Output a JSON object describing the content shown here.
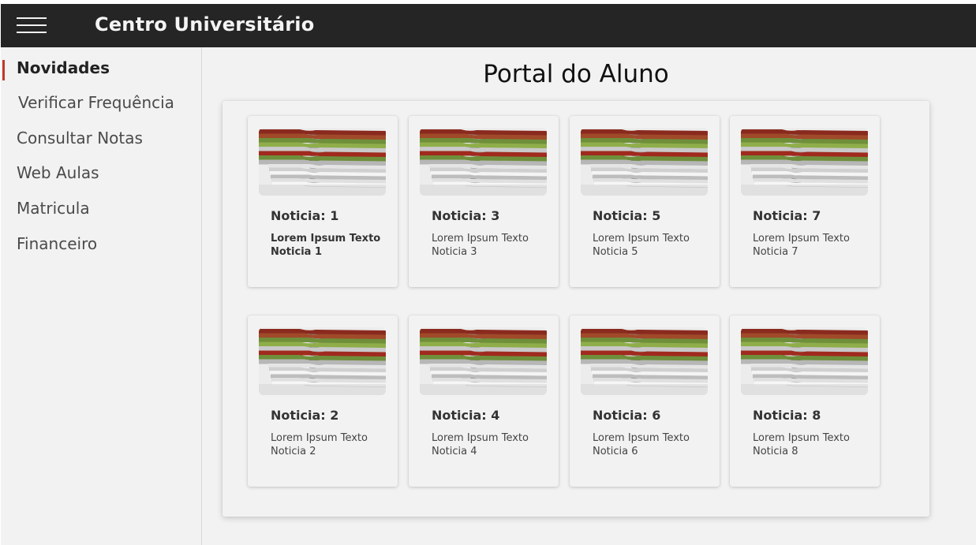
{
  "header": {
    "title": "Centro Universitário",
    "menu_icon": "hamburger-menu-icon"
  },
  "sidebar": {
    "items": [
      {
        "label": "Novidades",
        "active": true
      },
      {
        "label": "Verificar Frequência",
        "active": false
      },
      {
        "label": "Consultar Notas",
        "active": false
      },
      {
        "label": "Web Aulas",
        "active": false
      },
      {
        "label": "Matricula",
        "active": false
      },
      {
        "label": "Financeiro",
        "active": false
      }
    ]
  },
  "main": {
    "title": "Portal do Aluno",
    "cards": [
      {
        "title": "Noticia: 1",
        "text": "Lorem Ipsum Texto Noticia 1",
        "image": "newspaper-stack-image"
      },
      {
        "title": "Noticia: 3",
        "text": "Lorem Ipsum Texto Noticia 3",
        "image": "newspaper-stack-image"
      },
      {
        "title": "Noticia: 5",
        "text": "Lorem Ipsum Texto Noticia 5",
        "image": "newspaper-stack-image"
      },
      {
        "title": "Noticia: 7",
        "text": "Lorem Ipsum Texto Noticia 7",
        "image": "newspaper-stack-image"
      },
      {
        "title": "Noticia: 2",
        "text": "Lorem Ipsum Texto Noticia 2",
        "image": "newspaper-stack-image"
      },
      {
        "title": "Noticia: 4",
        "text": "Lorem Ipsum Texto Noticia 4",
        "image": "newspaper-stack-image"
      },
      {
        "title": "Noticia: 6",
        "text": "Lorem Ipsum Texto Noticia 6",
        "image": "newspaper-stack-image"
      },
      {
        "title": "Noticia: 8",
        "text": "Lorem Ipsum Texto Noticia 8",
        "image": "newspaper-stack-image"
      }
    ]
  },
  "colors": {
    "topbar": "#252525",
    "background": "#f2f2f2",
    "active_indicator": "#c0392b"
  }
}
